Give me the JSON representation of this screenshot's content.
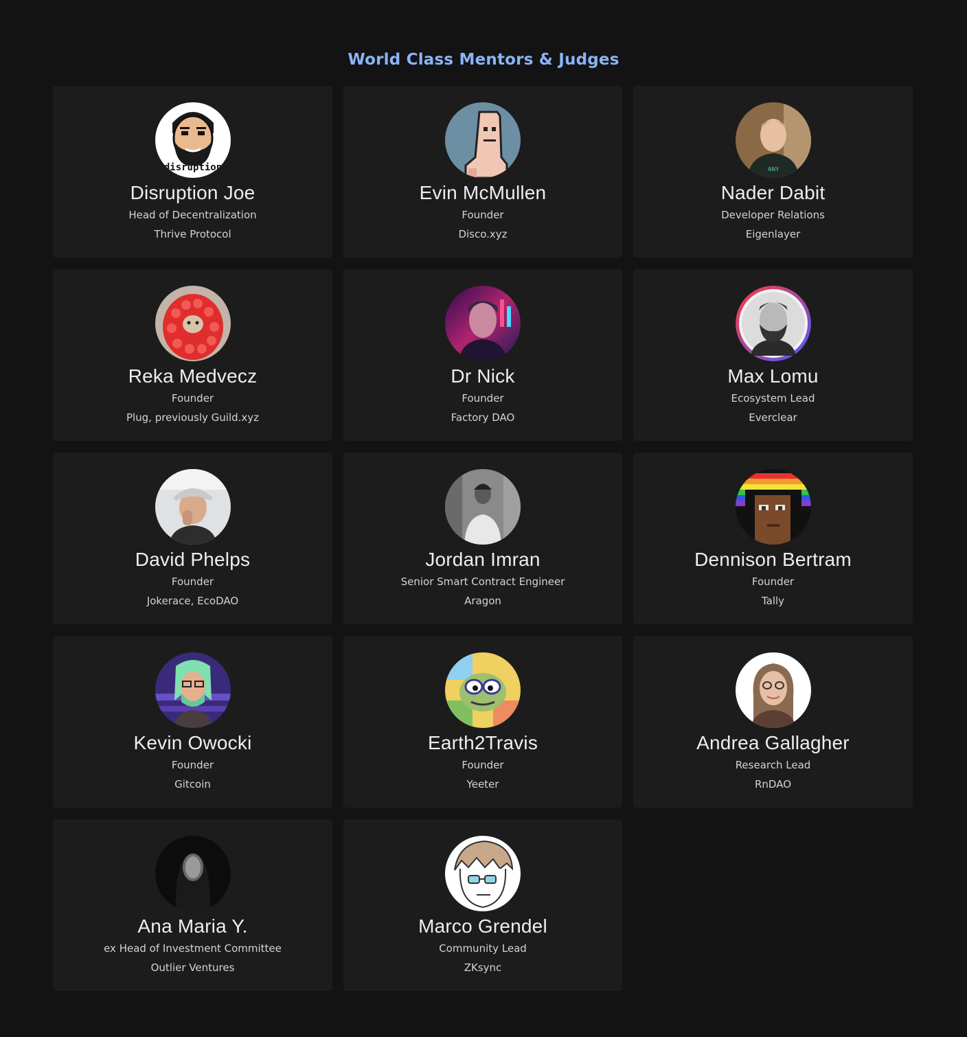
{
  "section": {
    "title": "World Class Mentors & Judges"
  },
  "mentors": [
    {
      "name": "Disruption Joe",
      "role": "Head of Decentralization",
      "org": "Thrive Protocol",
      "avatar_icon": "cartoon-bearded-man-avatar",
      "avatar_caption": "disruption"
    },
    {
      "name": "Evin McMullen",
      "role": "Founder",
      "org": "Disco.xyz",
      "avatar_icon": "pixel-pink-character-avatar"
    },
    {
      "name": "Nader Dabit",
      "role": "Developer Relations",
      "org": "Eigenlayer",
      "avatar_icon": "photo-man-hoodie-avatar"
    },
    {
      "name": "Reka Medvecz",
      "role": "Founder",
      "org": "Plug, previously Guild.xyz",
      "avatar_icon": "raspberry-cat-avatar"
    },
    {
      "name": "Dr Nick",
      "role": "Founder",
      "org": "Factory DAO",
      "avatar_icon": "cyberpunk-portrait-avatar"
    },
    {
      "name": "Max Lomu",
      "role": "Ecosystem Lead",
      "org": "Everclear",
      "avatar_icon": "bw-bearded-man-avatar"
    },
    {
      "name": "David Phelps",
      "role": "Founder",
      "org": "Jokerace, EcoDAO",
      "avatar_icon": "photo-man-cap-avatar"
    },
    {
      "name": "Jordan Imran",
      "role": "Senior Smart Contract Engineer",
      "org": "Aragon",
      "avatar_icon": "bw-photo-man-avatar"
    },
    {
      "name": "Dennison Bertram",
      "role": "Founder",
      "org": "Tally",
      "avatar_icon": "pixel-punk-rainbow-avatar"
    },
    {
      "name": "Kevin Owocki",
      "role": "Founder",
      "org": "Gitcoin",
      "avatar_icon": "pixel-green-hair-avatar"
    },
    {
      "name": "Earth2Travis",
      "role": "Founder",
      "org": "Yeeter",
      "avatar_icon": "colorful-frog-avatar"
    },
    {
      "name": "Andrea Gallagher",
      "role": "Research Lead",
      "org": "RnDAO",
      "avatar_icon": "photo-woman-glasses-avatar"
    },
    {
      "name": "Ana Maria Y.",
      "role": "ex Head of Investment Committee",
      "org": "Outlier Ventures",
      "avatar_icon": "dark-portrait-woman-avatar"
    },
    {
      "name": "Marco Grendel",
      "role": "Community Lead",
      "org": "ZKsync",
      "avatar_icon": "sketch-man-glasses-avatar"
    }
  ]
}
